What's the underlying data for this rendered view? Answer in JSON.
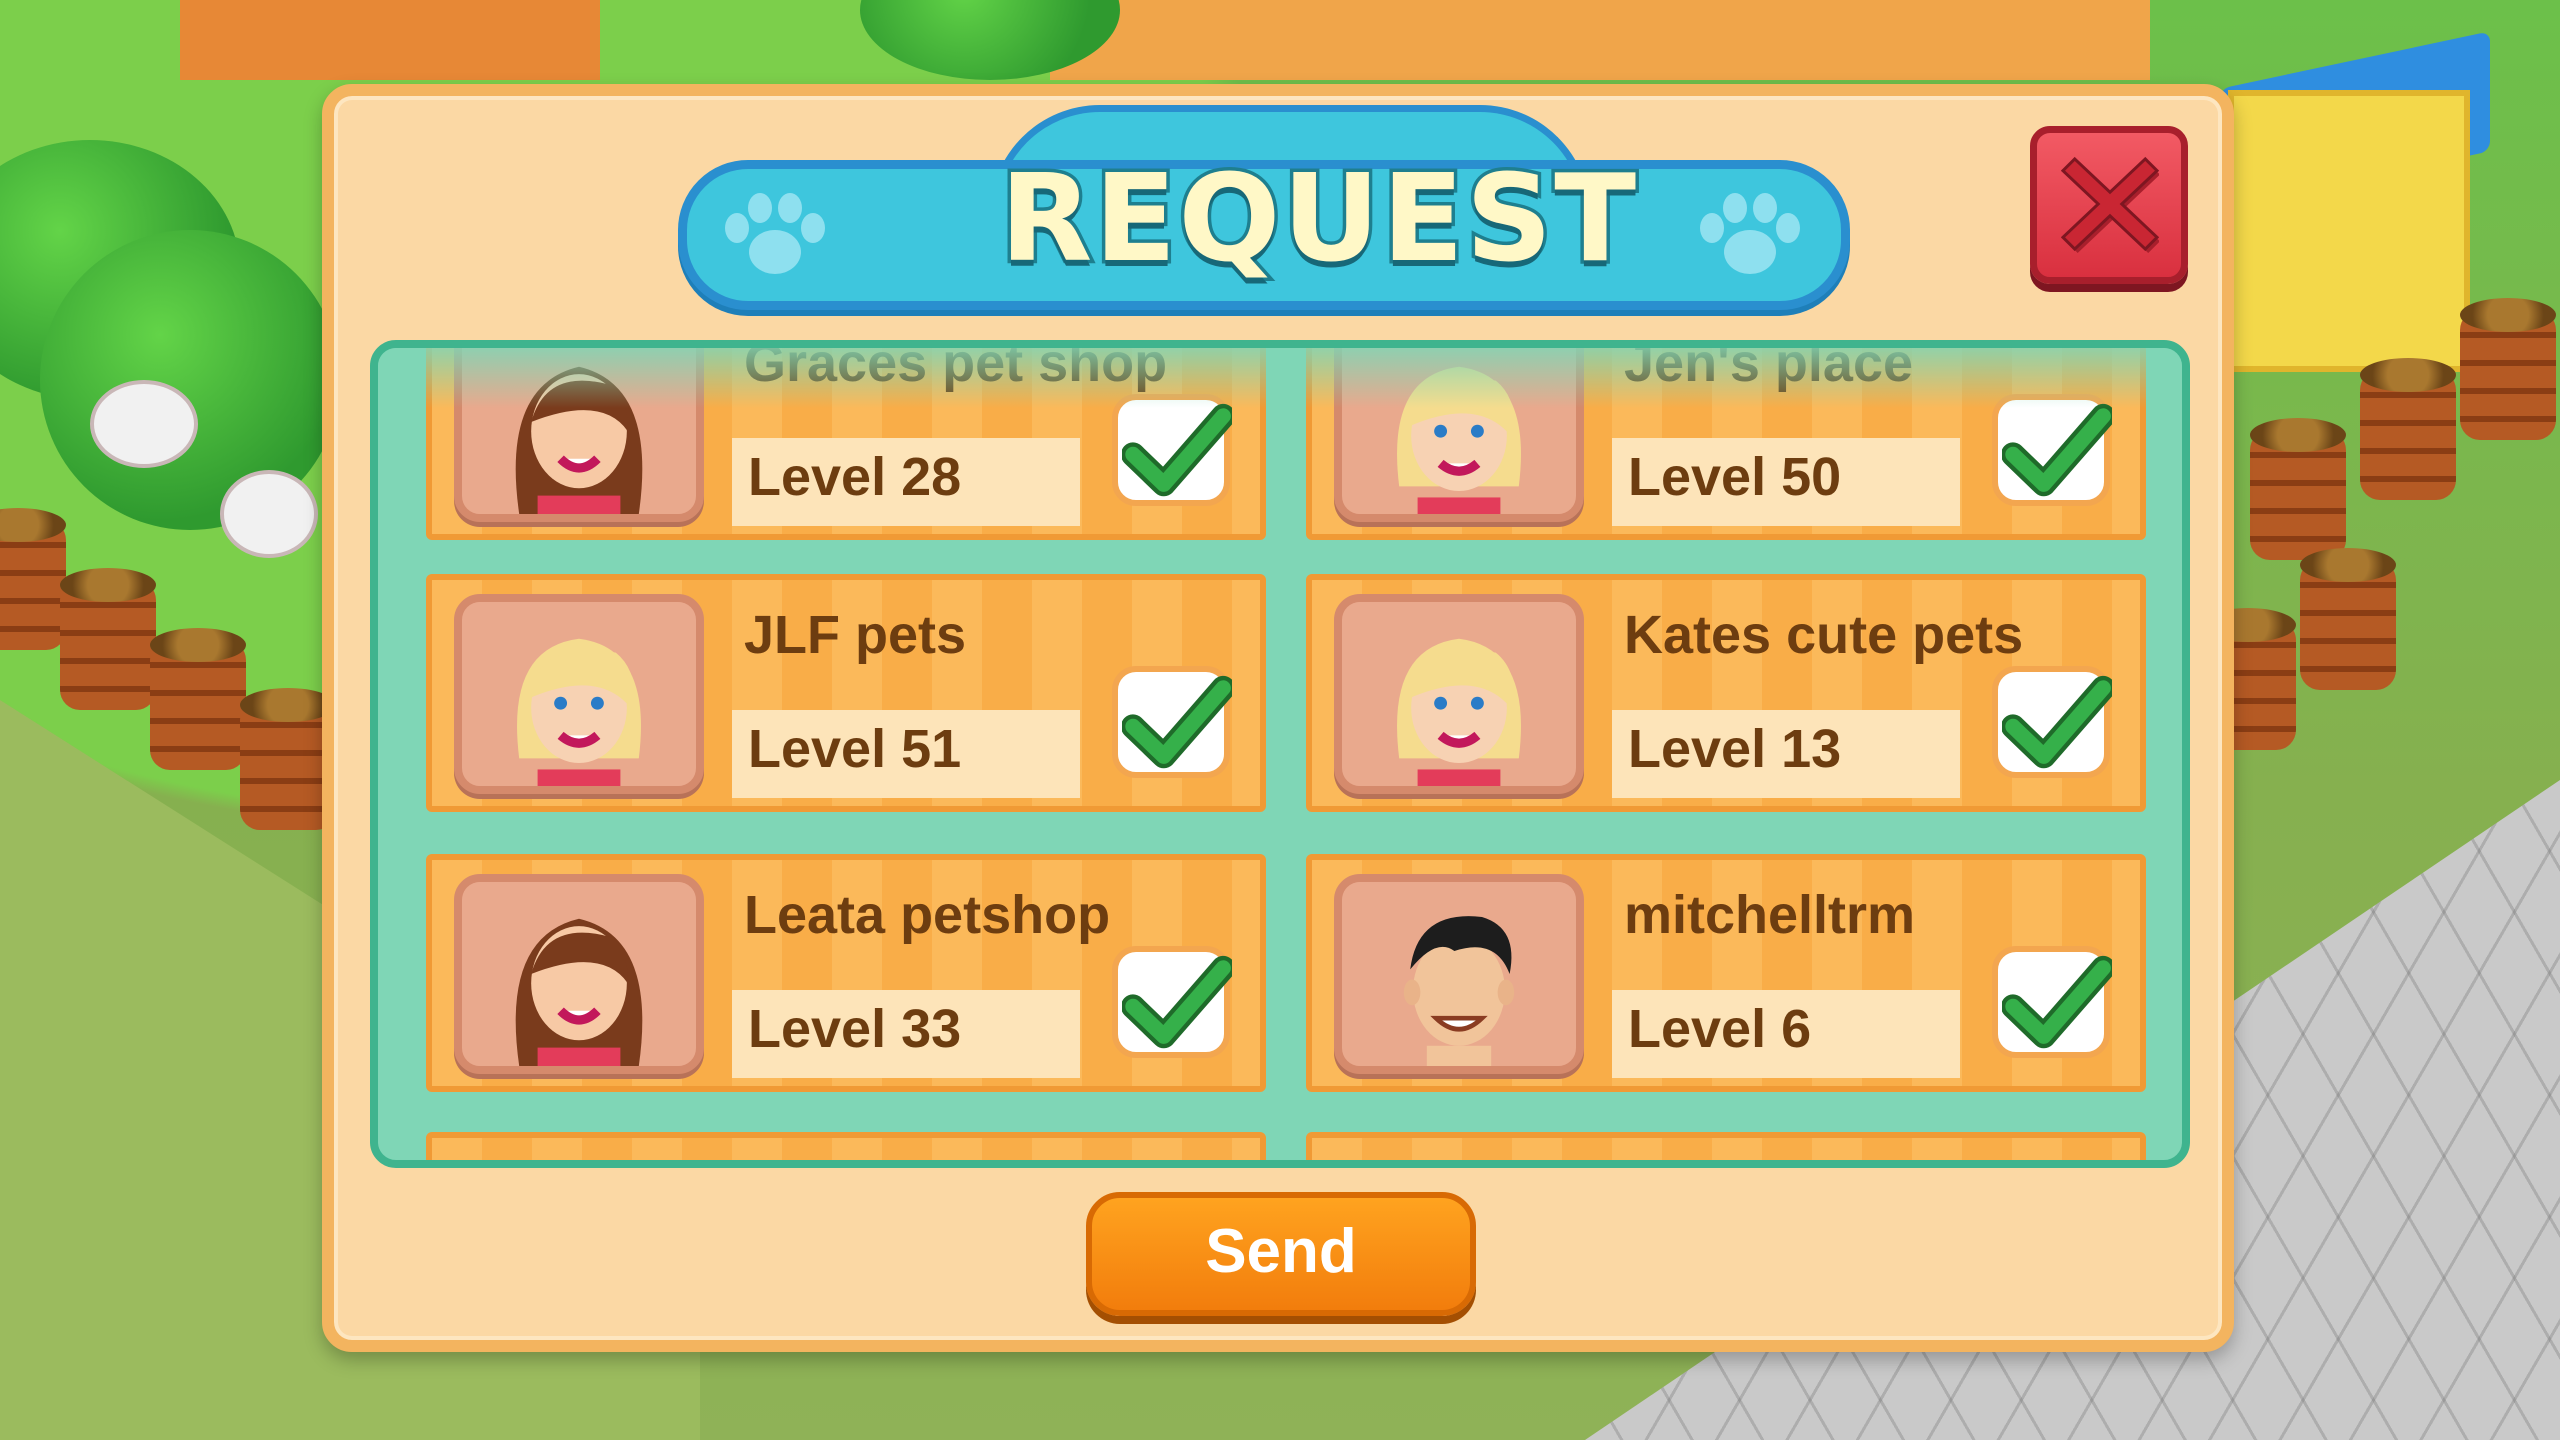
{
  "dialog": {
    "title": "REQUEST",
    "close_icon": "close-x-icon",
    "send_label": "Send"
  },
  "friends": [
    {
      "name": "Graces pet shop",
      "level": "Level 28",
      "avatar": "brunette-woman",
      "selected": true
    },
    {
      "name": "Jen's place",
      "level": "Level 50",
      "avatar": "blonde-woman",
      "selected": true
    },
    {
      "name": "JLF pets",
      "level": "Level 51",
      "avatar": "blonde-woman",
      "selected": true
    },
    {
      "name": "Kates cute pets",
      "level": "Level 13",
      "avatar": "blonde-woman",
      "selected": true
    },
    {
      "name": "Leata petshop",
      "level": "Level 33",
      "avatar": "brunette-woman",
      "selected": true
    },
    {
      "name": "mitchelltrm",
      "level": "Level 6",
      "avatar": "dark-hair-man",
      "selected": true
    }
  ],
  "colors": {
    "banner": "#3ec6dd",
    "panel": "#fbd8a4",
    "list_bg": "#7fd6b6",
    "card": "#fbb95a",
    "check": "#2ea043",
    "close": "#e03a47",
    "send": "#f58a12"
  }
}
